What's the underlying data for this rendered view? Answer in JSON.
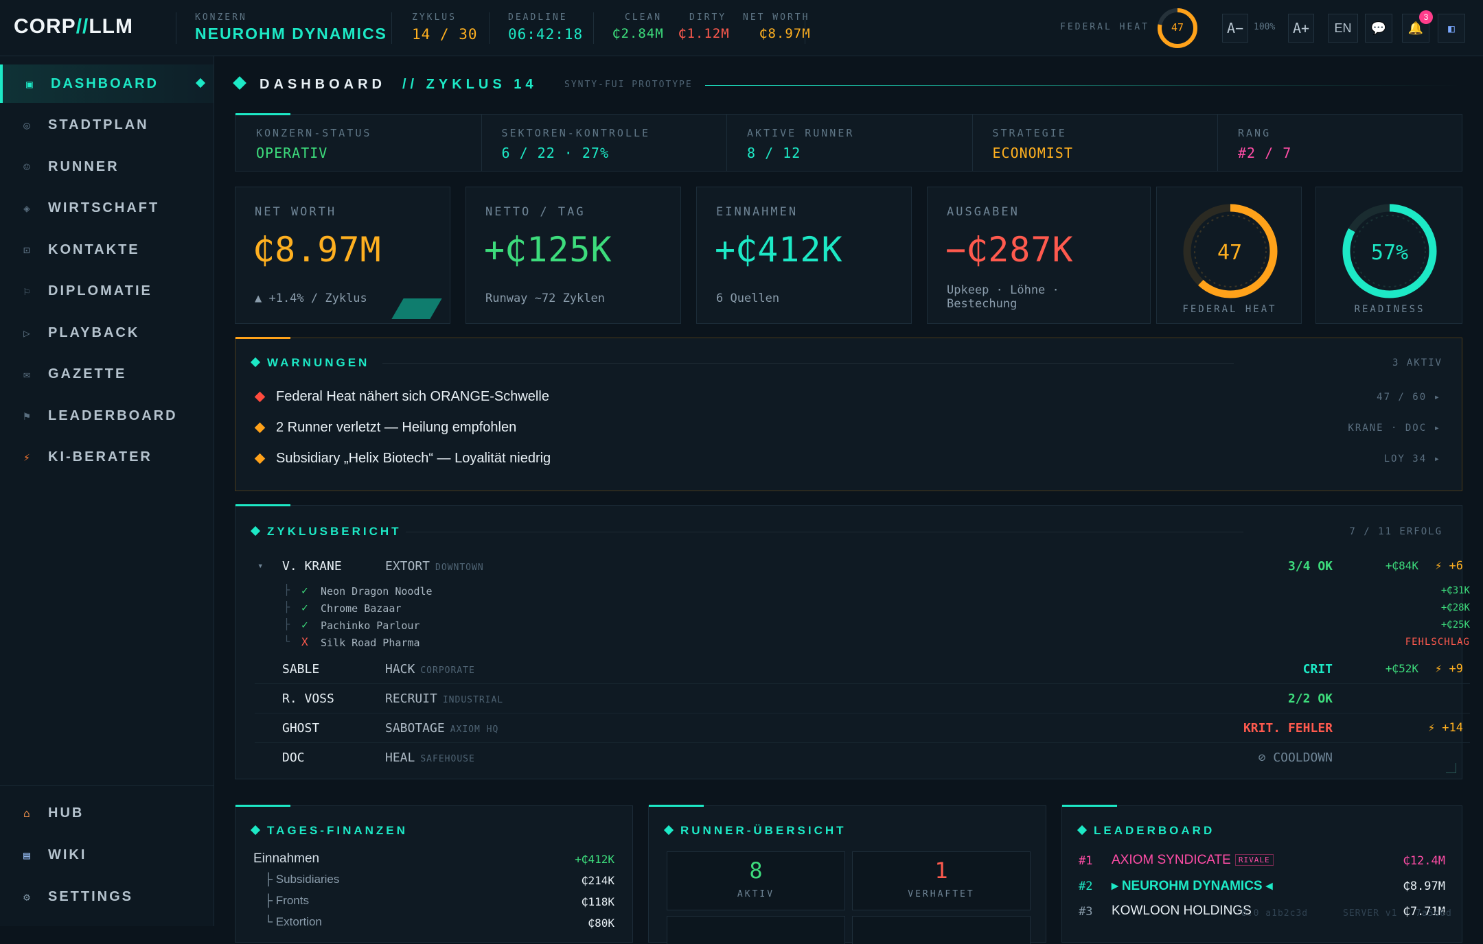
{
  "topbar": {
    "logo_a": "CORP",
    "logo_sep": "//",
    "logo_b": "LLM",
    "konzern_label": "KONZERN",
    "konzern_value": "NEUROHM DYNAMICS",
    "zyklus_label": "ZYKLUS",
    "zyklus_value": "14 / 30",
    "deadline_label": "DEADLINE",
    "deadline_value": "06:42:18",
    "clean_label": "CLEAN",
    "clean_value": "₵2.84M",
    "dirty_label": "DIRTY",
    "dirty_value": "₵1.12M",
    "networth_label": "NET WORTH",
    "networth_value": "₵8.97M",
    "heat_label": "FEDERAL HEAT",
    "heat_value": "47",
    "heat_fraction": 0.78,
    "font_minus": "A−",
    "zoom": "100%",
    "font_plus": "A+",
    "language": "EN",
    "notifications_count": "3"
  },
  "sidebar": {
    "items": [
      {
        "label": "DASHBOARD",
        "icon": "dashboard-icon",
        "glyph": "▣"
      },
      {
        "label": "STADTPLAN",
        "icon": "map-icon",
        "glyph": "◎"
      },
      {
        "label": "RUNNER",
        "icon": "runner-icon",
        "glyph": "☺"
      },
      {
        "label": "WIRTSCHAFT",
        "icon": "economy-icon",
        "glyph": "◈"
      },
      {
        "label": "KONTAKTE",
        "icon": "contacts-icon",
        "glyph": "⊡"
      },
      {
        "label": "DIPLOMATIE",
        "icon": "flag-icon",
        "glyph": "⚐"
      },
      {
        "label": "PLAYBACK",
        "icon": "play-icon",
        "glyph": "▷"
      },
      {
        "label": "GAZETTE",
        "icon": "mail-icon",
        "glyph": "✉"
      },
      {
        "label": "LEADERBOARD",
        "icon": "leaderboard-flag-icon",
        "glyph": "⚑"
      },
      {
        "label": "KI-BERATER",
        "icon": "lightning-icon",
        "glyph": "⚡"
      }
    ],
    "bottom": [
      {
        "label": "HUB",
        "icon": "home-icon",
        "glyph": "⌂"
      },
      {
        "label": "WIKI",
        "icon": "book-icon",
        "glyph": "▤"
      },
      {
        "label": "SETTINGS",
        "icon": "gear-icon",
        "glyph": "⚙"
      }
    ]
  },
  "header": {
    "title": "DASHBOARD",
    "subtitle": "// ZYKLUS 14",
    "tag": "SYNTY-FUI PROTOTYPE"
  },
  "status_strip": [
    {
      "label": "KONZERN-STATUS",
      "value": "OPERATIV",
      "color": "#3ddc7c"
    },
    {
      "label": "SEKTOREN-KONTROLLE",
      "value": "6 / 22 · 27%",
      "color": "#1de9c6"
    },
    {
      "label": "AKTIVE RUNNER",
      "value": "8 / 12",
      "color": "#1de9c6"
    },
    {
      "label": "STRATEGIE",
      "value": "ECONOMIST",
      "color": "#ffb020"
    },
    {
      "label": "RANG",
      "value": "#2 / 7",
      "color": "#ff4da6"
    }
  ],
  "kpis": {
    "networth": {
      "label": "NET WORTH",
      "value": "₵8.97M",
      "sub": "▲ +1.4% / Zyklus"
    },
    "netto": {
      "label": "NETTO / TAG",
      "value": "+₵125K",
      "sub": "Runway ~72 Zyklen"
    },
    "einnahmen": {
      "label": "EINNAHMEN",
      "value": "+₵412K",
      "sub": "6 Quellen"
    },
    "ausgaben": {
      "label": "AUSGABEN",
      "value": "−₵287K",
      "sub": "Upkeep · Löhne · Bestechung"
    },
    "heat": {
      "label": "FEDERAL HEAT",
      "value": "47",
      "fraction": 0.62
    },
    "readiness": {
      "label": "READINESS",
      "value": "57%",
      "fraction": 0.83
    }
  },
  "warnings": {
    "title": "WARNUNGEN",
    "count": "3 AKTIV",
    "items": [
      {
        "text": "Federal Heat nähert sich ORANGE-Schwelle",
        "meta": "47 / 60  ▸",
        "color": "#ff4b3e"
      },
      {
        "text": "2 Runner verletzt — Heilung empfohlen",
        "meta": "KRANE · DOC  ▸",
        "color": "#ffa21a"
      },
      {
        "text": "Subsidiary „Helix Biotech“ — Loyalität niedrig",
        "meta": "LOY 34  ▸",
        "color": "#ffa21a"
      }
    ]
  },
  "report": {
    "title": "ZYKLUSBERICHT",
    "count": "7 / 11 ERFOLG",
    "krane": {
      "toggle": "▾",
      "name": "V. KRANE",
      "action": "EXTORT",
      "loc": "DOWNTOWN",
      "status": "3/4 OK",
      "money": "+₵84K",
      "heat": "⚡ +6",
      "subs": [
        {
          "tree": "├",
          "mark": "✓",
          "name": "Neon Dragon Noodle",
          "amount": "+₵31K",
          "ok": true
        },
        {
          "tree": "├",
          "mark": "✓",
          "name": "Chrome Bazaar",
          "amount": "+₵28K",
          "ok": true
        },
        {
          "tree": "├",
          "mark": "✓",
          "name": "Pachinko Parlour",
          "amount": "+₵25K",
          "ok": true
        },
        {
          "tree": "└",
          "mark": "X",
          "name": "Silk Road Pharma",
          "amount": "FEHLSCHLAG",
          "ok": false
        }
      ]
    },
    "rows": [
      {
        "name": "SABLE",
        "action": "HACK",
        "loc": "CORPORATE",
        "status": "CRIT",
        "status_color": "#1de9c6",
        "money": "+₵52K",
        "heat": "⚡ +9"
      },
      {
        "name": "R. VOSS",
        "action": "RECRUIT",
        "loc": "INDUSTRIAL",
        "status": "2/2 OK",
        "status_color": "#3ddc7c",
        "money": "",
        "heat": ""
      },
      {
        "name": "GHOST",
        "action": "SABOTAGE",
        "loc": "AXIOM HQ",
        "status": "KRIT. FEHLER",
        "status_color": "#ff5a4e",
        "money": "",
        "heat": "⚡ +14"
      },
      {
        "name": "DOC",
        "action": "HEAL",
        "loc": "SAFEHOUSE",
        "status": "⊘ COOLDOWN",
        "status_color": "#6f8596",
        "money": "",
        "heat": ""
      }
    ]
  },
  "finances": {
    "title": "TAGES-FINANZEN",
    "rows": [
      {
        "label": "Einnahmen",
        "value": "+₵412K"
      },
      {
        "label": "├ Subsidiaries",
        "value": "₵214K"
      },
      {
        "label": "├ Fronts",
        "value": "₵118K"
      },
      {
        "label": "└ Extortion",
        "value": "₵80K"
      }
    ]
  },
  "runners": {
    "title": "RUNNER-ÜBERSICHT",
    "aktiv_value": "8",
    "aktiv_label": "AKTIV",
    "verhaftet_value": "1",
    "verhaftet_label": "VERHAFTET"
  },
  "leaderboard": {
    "title": "LEADERBOARD",
    "rows": [
      {
        "rank": "#1",
        "name": "AXIOM SYNDICATE",
        "tag": "RIVALE",
        "value": "₵12.4M"
      },
      {
        "rank": "#2",
        "name": "▸ NEUROHM DYNAMICS ◂",
        "tag": "",
        "value": "₵8.97M"
      },
      {
        "rank": "#3",
        "name": "KOWLOON HOLDINGS",
        "tag": "",
        "value": "₵7.71M"
      }
    ]
  },
  "footer": {
    "build": "8.0 a1b2c3d",
    "server": "SERVER v1 · 7a5c6d"
  },
  "colors": {
    "accent": "#1de9c6",
    "green": "#3ddc7c",
    "red": "#ff5a4e",
    "orange": "#ffb020",
    "pink": "#ff4da6"
  }
}
